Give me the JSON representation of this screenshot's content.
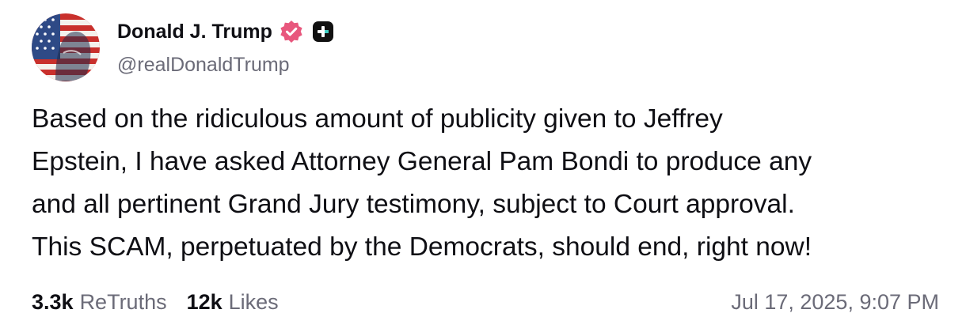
{
  "author": {
    "display_name": "Donald J. Trump",
    "handle": "@realDonaldTrump",
    "avatar_icon": "flag-portrait-avatar",
    "verified_icon": "verified-badge-icon",
    "verified_color": "#e8577d",
    "plus_icon": "plus-badge-icon",
    "plus_color": "#111111"
  },
  "post": {
    "lines": [
      "Based on the ridiculous amount of publicity given to Jeffrey",
      "Epstein, I have asked Attorney General Pam Bondi to produce any",
      "and all pertinent Grand Jury testimony, subject to Court approval.",
      "This SCAM, perpetuated by the Democrats, should end, right now!"
    ]
  },
  "stats": {
    "retruths_count": "3.3k",
    "retruths_label": "ReTruths",
    "likes_count": "12k",
    "likes_label": "Likes"
  },
  "timestamp": "Jul 17, 2025, 9:07 PM"
}
